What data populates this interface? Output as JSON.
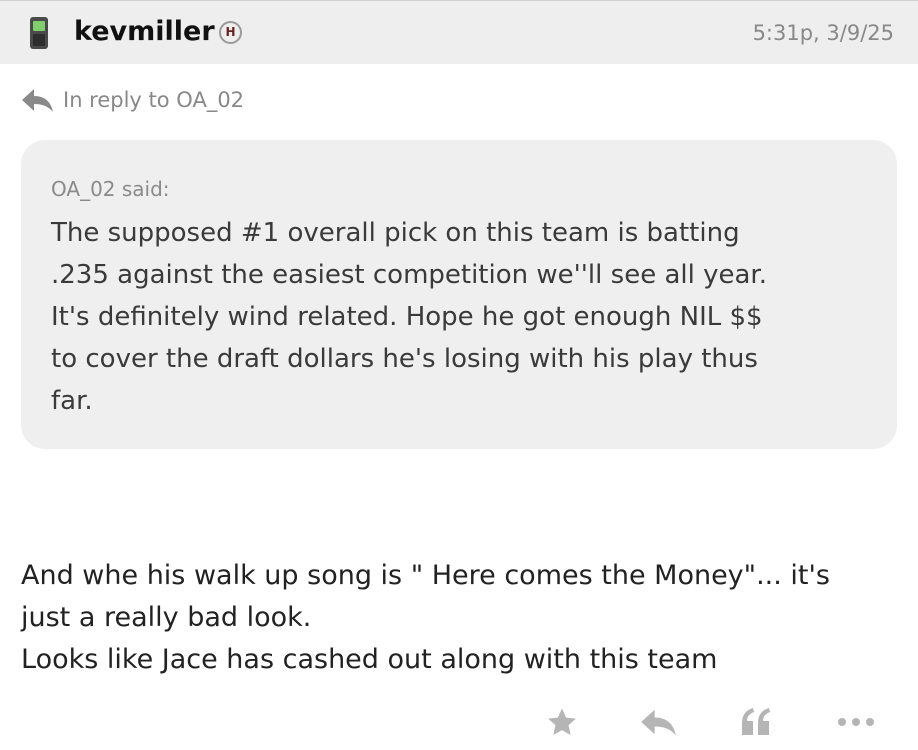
{
  "header": {
    "username": "kevmiller",
    "badge": "H",
    "timestamp": "5:31p, 3/9/25",
    "device_icon": "phone-icon"
  },
  "reply": {
    "icon": "reply-arrow-icon",
    "text": "In reply to OA_02"
  },
  "quote": {
    "author": "OA_02 said:",
    "lines": [
      "The supposed #1 overall pick on this team is batting",
      ".235 against the easiest competition we''ll see all year.",
      "It's definitely wind related. Hope he got enough NIL $$",
      "to cover the draft dollars he's losing with his play thus",
      "far."
    ]
  },
  "post": {
    "lines": [
      "And whe his walk up song is \" Here comes the Money\"... it's",
      "just a really bad look.",
      "Looks like Jace has cashed out along with this team"
    ]
  },
  "actions": [
    {
      "name": "star-icon"
    },
    {
      "name": "reply-icon"
    },
    {
      "name": "quote-icon"
    },
    {
      "name": "more-icon"
    }
  ],
  "colors": {
    "header_bg": "#eeeeee",
    "quote_bg": "#efefef",
    "muted_text": "#888888",
    "icon_gray": "#b5b5b5"
  }
}
